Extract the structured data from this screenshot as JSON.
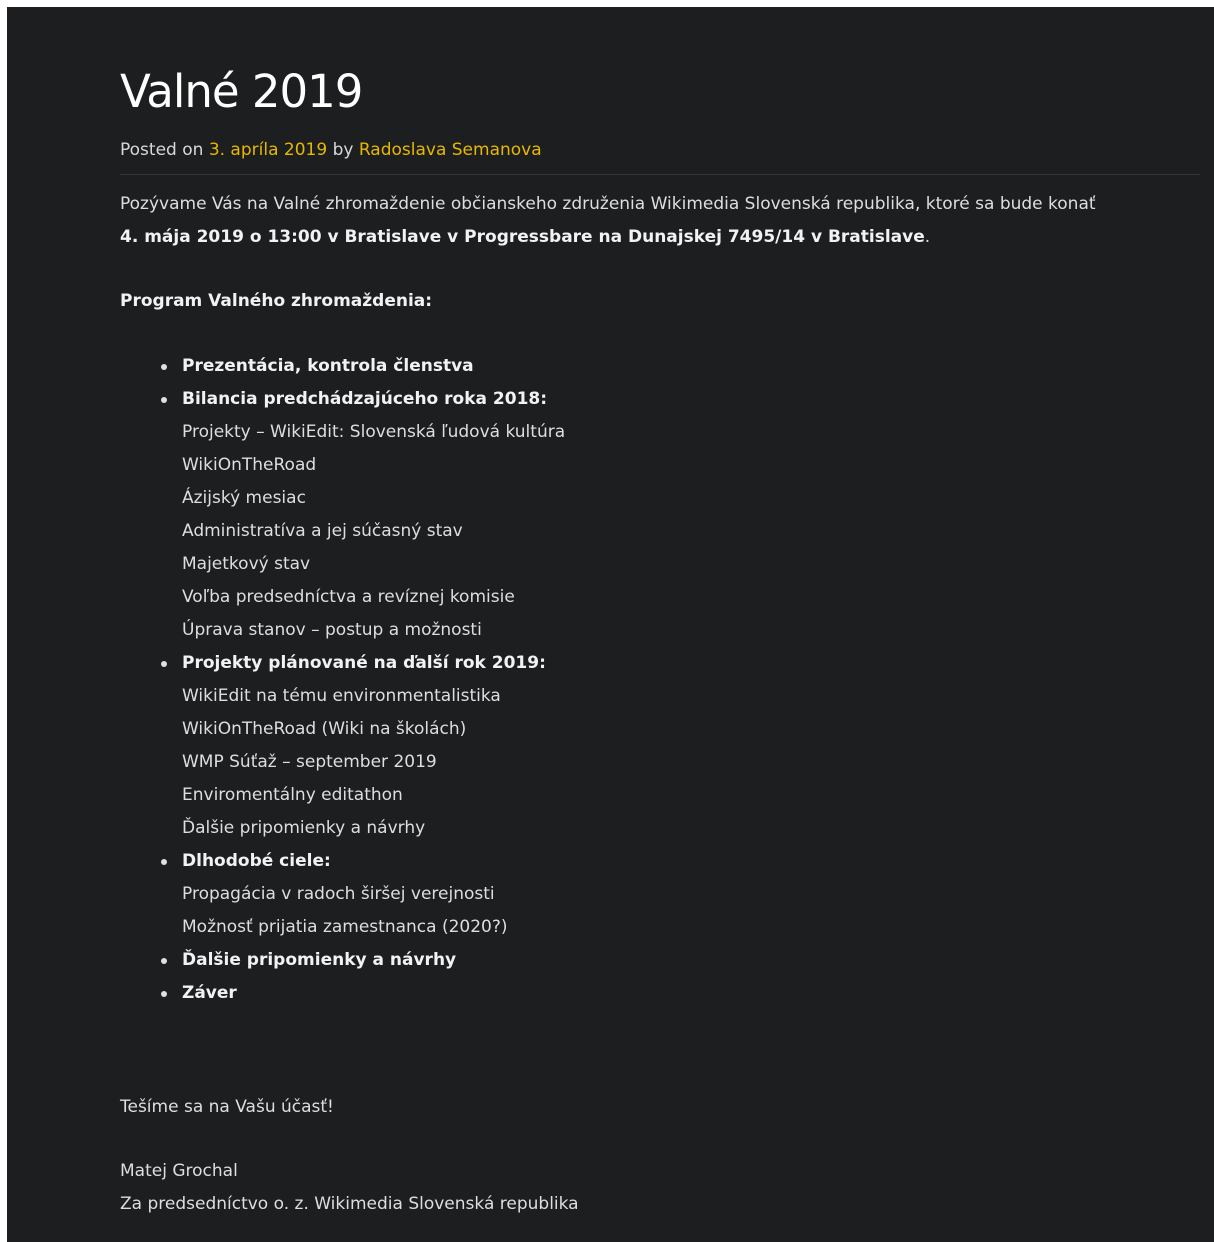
{
  "post": {
    "title": "Valné 2019",
    "posted_on_label": "Posted on",
    "date": "3. apríla 2019",
    "by_label": "by",
    "author": "Radoslava Semanova"
  },
  "content": {
    "intro_text": "Pozývame Vás na Valné zhromaždenie občianskeho združenia Wikimedia Slovenská republika, ktoré sa bude konať",
    "intro_bold": "4. mája 2019 o 13:00 v Bratislave v Progressbare na Dunajskej 7495/14 v Bratislave",
    "intro_end": ".",
    "program_heading": "Program Valného zhromaždenia:",
    "agenda": [
      {
        "head": "Prezentácia, kontrola členstva",
        "subs": []
      },
      {
        "head": "Bilancia predchádzajúceho roka 2018:",
        "subs": [
          "Projekty – WikiEdit: Slovenská ľudová kultúra",
          "WikiOnTheRoad",
          "Ázijský mesiac",
          "Administratíva a jej súčasný stav",
          "Majetkový stav",
          "Voľba predsedníctva a revíznej komisie",
          "Úprava stanov – postup a možnosti"
        ]
      },
      {
        "head": "Projekty plánované na ďalší rok 2019:",
        "subs": [
          "WikiEdit na tému environmentalistika",
          "WikiOnTheRoad (Wiki na školách)",
          "WMP Súťaž – september 2019",
          "Enviromentálny editathon",
          "Ďalšie pripomienky a návrhy"
        ]
      },
      {
        "head": "Dlhodobé ciele:",
        "subs": [
          "Propagácia v radoch širšej verejnosti",
          "Možnosť prijatia zamestnanca (2020?)"
        ]
      },
      {
        "head": "Ďalšie pripomienky a návrhy",
        "subs": []
      },
      {
        "head": "Záver",
        "subs": []
      }
    ],
    "closing": "Tešíme sa na Vašu účasť!",
    "signature_name": "Matej Grochal",
    "signature_org": "Za predsedníctvo o. z. Wikimedia Slovenská republika"
  },
  "colors": {
    "background": "#1d1e20",
    "link": "#e6b800",
    "text": "#dedede"
  }
}
